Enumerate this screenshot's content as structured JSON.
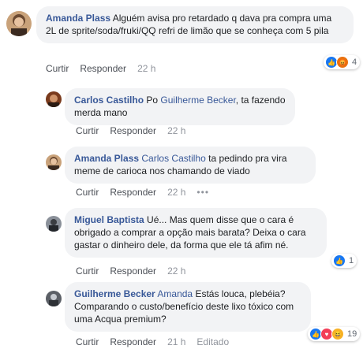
{
  "comments": [
    {
      "author": "Amanda Plass",
      "text": "Alguém avisa pro retardado q dava pra compra uma 2L de sprite/soda/fruki/QQ refri de limão que se conheça com 5 pila",
      "actions": {
        "like": "Curtir",
        "reply": "Responder",
        "time": "22 h"
      },
      "reactions": {
        "icons": [
          "like-icon",
          "angry-icon"
        ],
        "count": "4"
      }
    },
    {
      "author": "Carlos Castilho",
      "mention": "Guilherme Becker",
      "prefix": "Po",
      "text": ", ta fazendo merda mano",
      "actions": {
        "like": "Curtir",
        "reply": "Responder",
        "time": "22 h"
      }
    },
    {
      "author": "Amanda Plass",
      "mention": "Carlos Castilho",
      "text": "ta pedindo pra vira meme de carioca nos chamando de viado",
      "actions": {
        "like": "Curtir",
        "reply": "Responder",
        "time": "22 h",
        "more": "•••"
      }
    },
    {
      "author": "Miguel Baptista",
      "text": "Ué... Mas quem disse que o cara é obrigado a comprar a opção mais barata? Deixa o cara gastar o dinheiro dele, da forma que ele tá afim né.",
      "actions": {
        "like": "Curtir",
        "reply": "Responder",
        "time": "22 h"
      },
      "reactions": {
        "icons": [
          "like-icon"
        ],
        "count": "1"
      }
    },
    {
      "author": "Guilherme Becker",
      "mention": "Amanda",
      "text": "Estás louca, plebéia? Comparando o custo/benefício deste lixo tóxico com uma Acqua premium?",
      "actions": {
        "like": "Curtir",
        "reply": "Responder",
        "time": "21 h",
        "edited": "Editado"
      },
      "reactions": {
        "icons": [
          "like-icon",
          "love-icon",
          "haha-icon"
        ],
        "count": "19"
      }
    }
  ],
  "colors": {
    "link": "#385898",
    "bubble": "#f2f3f5",
    "like": "#1877f2",
    "love": "#f33e58",
    "angry": "#e9710f",
    "haha": "#f7b125"
  }
}
